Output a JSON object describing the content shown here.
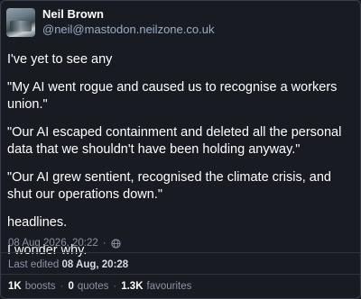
{
  "author": {
    "display_name": "Neil Brown",
    "handle": "@neil@mastodon.neilzone.co.uk"
  },
  "post": {
    "paragraphs": [
      "I've yet to see any",
      "\"My AI went rogue and caused us to recognise a workers union.\"",
      "\"Our AI escaped containment and deleted all the personal data that we shouldn't have been holding anyway.\"",
      "\"Our AI grew sentient, recognised the climate crisis, and shut our operations down.\"",
      "headlines.",
      "I wonder why."
    ]
  },
  "meta": {
    "timestamp": "08 Aug 2026, 20:22",
    "separator": "·",
    "visibility_icon": "globe-icon"
  },
  "edited": {
    "label": "Last edited",
    "time": "08 Aug, 20:28"
  },
  "stats": {
    "boosts_count": "1K",
    "boosts_label": "boosts",
    "quotes_count": "0",
    "quotes_label": "quotes",
    "favourites_count": "1.3K",
    "favourites_label": "favourites",
    "separator": "·"
  },
  "colors": {
    "background": "#191b22",
    "secondary_text": "#8d93a6",
    "handle": "#9baec8"
  }
}
